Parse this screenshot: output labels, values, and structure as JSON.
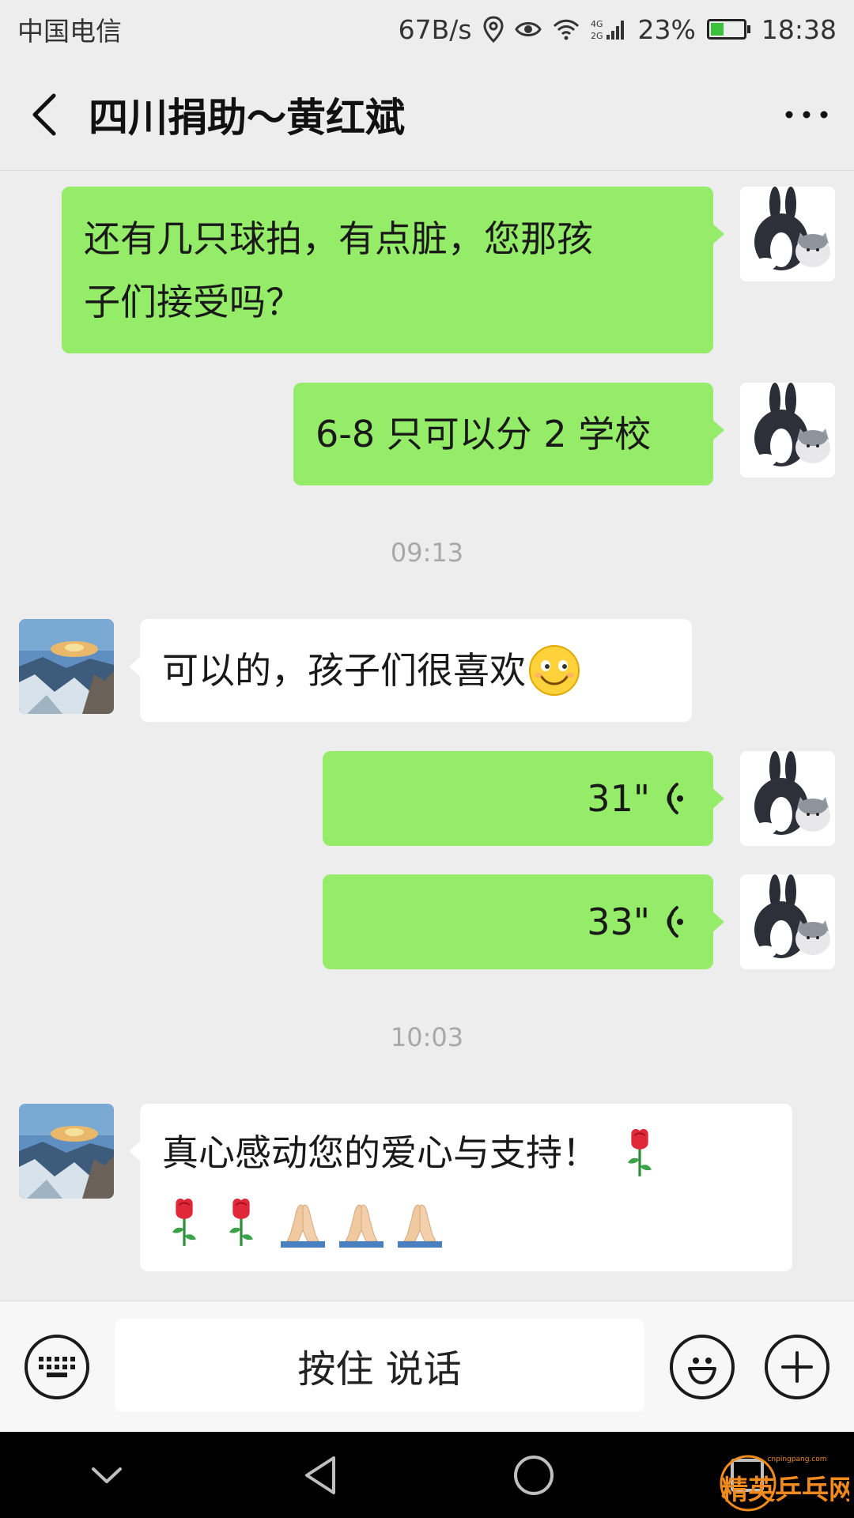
{
  "status_bar": {
    "carrier": "中国电信",
    "speed": "67B/s",
    "network": "4G",
    "battery": "23%",
    "time": "18:38"
  },
  "header": {
    "title": "四川捐助～黄红斌",
    "back_icon": "chevron-left-icon",
    "more_icon": "ellipsis-icon"
  },
  "messages": [
    {
      "direction": "out",
      "type": "text",
      "text_line1": "还有几只球拍，有点脏，您那孩",
      "text_line2": "子们接受吗？"
    },
    {
      "direction": "out",
      "type": "text",
      "text": "6-8 只可以分 2 学校"
    },
    {
      "type": "timestamp",
      "text": "09:13"
    },
    {
      "direction": "in",
      "type": "text",
      "text": "可以的，孩子们很喜欢",
      "emoji": "smile-emoji"
    },
    {
      "direction": "out",
      "type": "voice",
      "duration": "31\""
    },
    {
      "direction": "out",
      "type": "voice",
      "duration": "33\""
    },
    {
      "type": "timestamp",
      "text": "10:03"
    },
    {
      "direction": "in",
      "type": "text",
      "text": "真心感动您的爱心与支持！",
      "emojis": [
        "rose-emoji",
        "rose-emoji",
        "rose-emoji",
        "pray-emoji",
        "pray-emoji",
        "pray-emoji"
      ]
    }
  ],
  "input_bar": {
    "hold_to_talk": "按住 说话",
    "keyboard_icon": "keyboard-icon",
    "emoji_icon": "emoji-face-icon",
    "plus_icon": "plus-icon"
  },
  "nav_bar": {
    "icons": [
      "collapse-icon",
      "back-triangle-icon",
      "home-circle-icon",
      "recents-square-icon"
    ]
  },
  "colors": {
    "outgoing_bubble": "#95ec69",
    "incoming_bubble": "#ffffff",
    "background": "#ededed"
  },
  "watermark": {
    "text": "精英乒乓网",
    "url_text": "cnpingpang.com"
  }
}
